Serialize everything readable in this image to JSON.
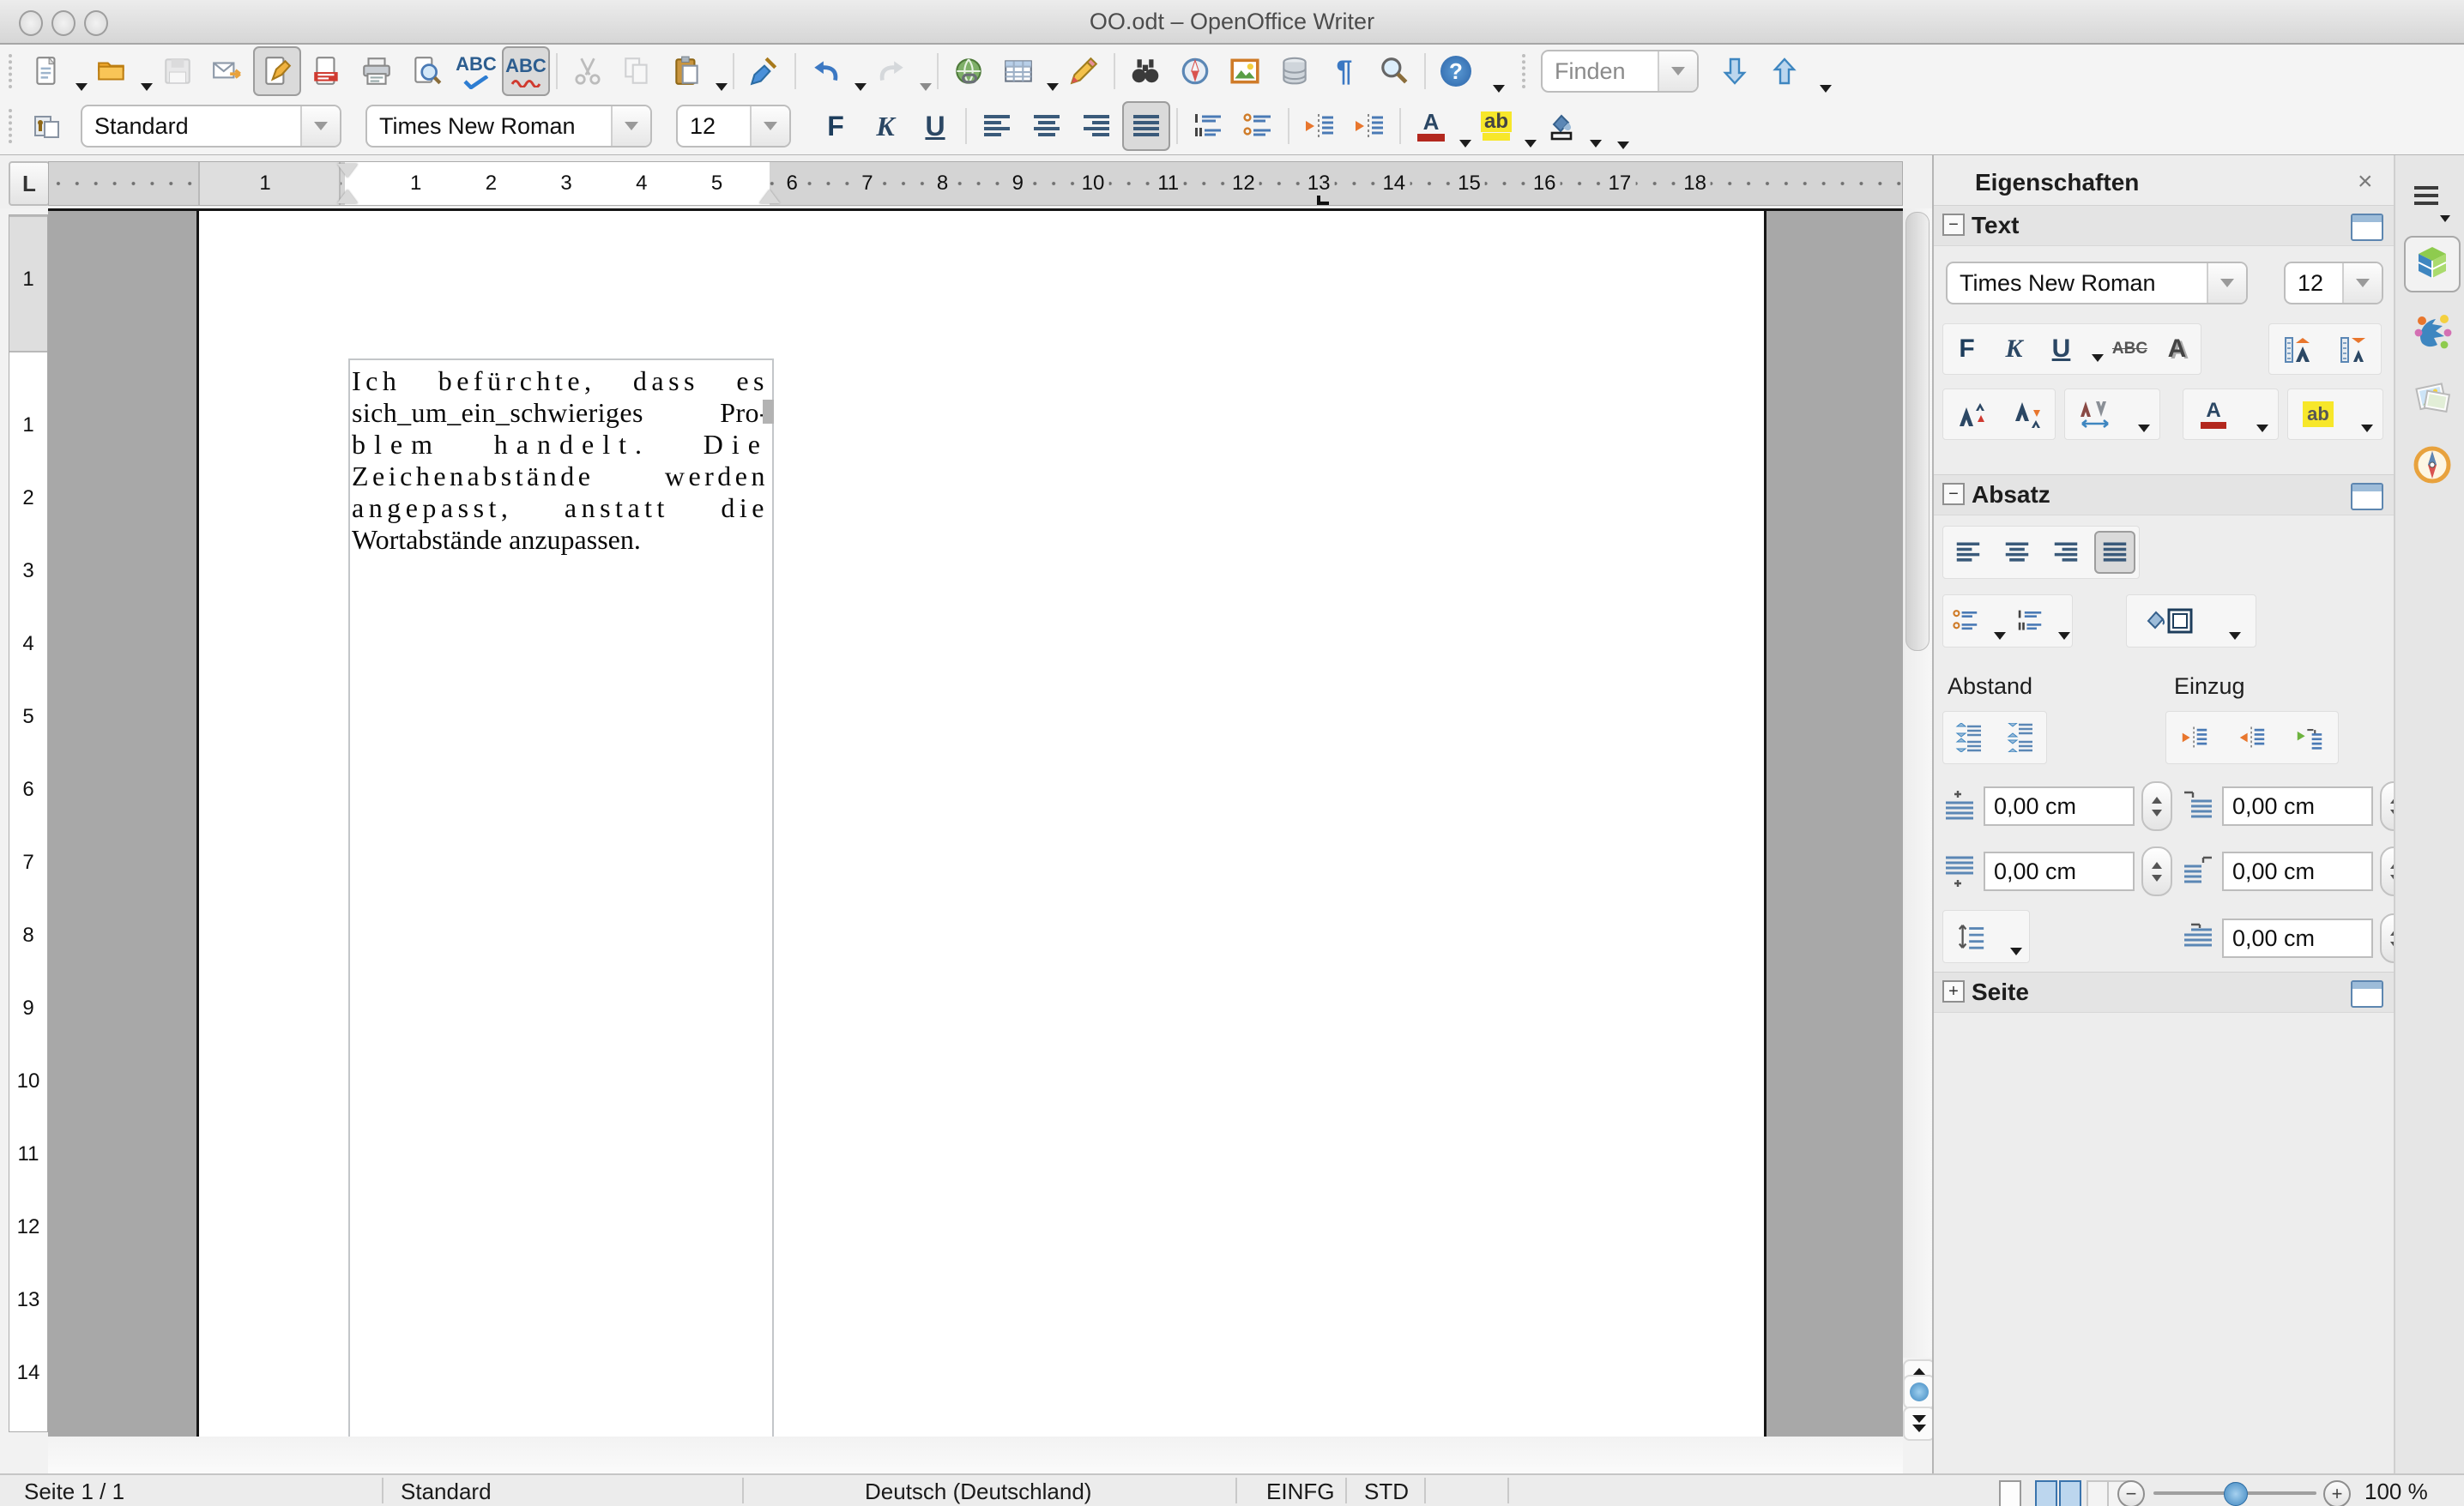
{
  "window": {
    "title": "OO.odt – OpenOffice Writer"
  },
  "glyphs": {
    "tab_type": "L",
    "bold": "F",
    "italic": "K",
    "underline": "U",
    "abc": "ABC",
    "letter_a": "A",
    "letter_ab": "ab",
    "letters_av": "AV",
    "pilcrow": "¶",
    "question": "?",
    "close": "×",
    "collapse": "−",
    "expand": "+",
    "minus": "−",
    "plus": "+"
  },
  "toolbar": {
    "find_placeholder": "Finden"
  },
  "format_toolbar": {
    "paragraph_style": "Standard",
    "font_name": "Times New Roman",
    "font_size": "12"
  },
  "ruler": {
    "h_margin_label": "1",
    "h_numbers": [
      "1",
      "2",
      "3",
      "4",
      "5",
      "6",
      "7",
      "8",
      "9",
      "10",
      "11",
      "12",
      "13",
      "14",
      "15",
      "16",
      "17",
      "18"
    ],
    "v_margin_label": "1",
    "v_numbers": [
      "1",
      "2",
      "3",
      "4",
      "5",
      "6",
      "7",
      "8",
      "9",
      "10",
      "11",
      "12",
      "13",
      "14"
    ]
  },
  "document": {
    "lines": [
      "Ich befürchte, dass es",
      "sich_um_ein_schwieriges Pro-",
      "blem handelt. Die",
      "Zeichenabstände werden",
      "angepasst, anstatt die",
      "Wortabstände anzupassen."
    ]
  },
  "sidebar": {
    "title": "Eigenschaften",
    "text_section": {
      "label": "Text",
      "font_name": "Times New Roman",
      "font_size": "12"
    },
    "paragraph_section": {
      "label": "Absatz",
      "spacing_label": "Abstand",
      "indent_label": "Einzug",
      "spacing_above": "0,00 cm",
      "spacing_below": "0,00 cm",
      "indent_before": "0,00 cm",
      "indent_after": "0,00 cm",
      "indent_firstline": "0,00 cm"
    },
    "page_section": {
      "label": "Seite"
    }
  },
  "status_bar": {
    "page": "Seite 1 / 1",
    "style": "Standard",
    "language": "Deutsch (Deutschland)",
    "insert_mode": "EINFG",
    "selection_mode": "STD",
    "zoom": "100 %"
  },
  "icons": {
    "new-document-icon": "white page with fold",
    "open-icon": "orange folder",
    "save-icon": "floppy disk (disabled)",
    "mail-icon": "envelope with arrow",
    "edit-mode-icon": "page with pencil (active)",
    "export-pdf-icon": "page with red PDF band",
    "print-icon": "printer",
    "page-preview-icon": "page with magnifier",
    "spellcheck-icon": "ABC with check",
    "autospellcheck-icon": "ABC with red wave (active)",
    "cut-icon": "scissors (disabled)",
    "copy-icon": "two pages (disabled)",
    "paste-icon": "clipboard",
    "format-paintbrush-icon": "blue brush",
    "undo-icon": "blue curved arrow",
    "redo-icon": "gray curved arrow (disabled)",
    "hyperlink-icon": "globe with chain",
    "table-icon": "grid",
    "draw-functions-icon": "pencil",
    "find-replace-icon": "binoculars",
    "navigator-icon": "compass",
    "gallery-icon": "picture frame",
    "data-sources-icon": "database cylinder",
    "formatting-marks-icon": "pilcrow",
    "zoom-icon": "magnifier",
    "help-icon": "blue circle question mark",
    "align-left-icon": "bars left",
    "align-center-icon": "bars centered",
    "align-right-icon": "bars right",
    "justify-icon": "bars justified (active)",
    "numbered-list-icon": "numbered lines",
    "bullet-list-icon": "bulleted lines",
    "decrease-indent-icon": "orange arrow left",
    "increase-indent-icon": "orange arrow right",
    "font-color-icon": "A over red bar",
    "highlight-icon": "ab on yellow",
    "background-color-icon": "paint bucket",
    "increase-font-icon": "ruler A up triangle",
    "decrease-font-icon": "ruler A down triangle",
    "superscript-icon": "A raised",
    "subscript-icon": "A lowered",
    "char-spacing-icon": "AV with arrows",
    "spacing-up-icon": "paragraph spacing increase",
    "spacing-down-icon": "paragraph spacing decrease",
    "hanging-indent-icon": "green arrow indent",
    "line-spacing-icon": "vertical arrow with lines",
    "paragraph-background-icon": "bucket with square",
    "properties-tab-icon": "green blue cube (selected)",
    "styles-tab-icon": "stars and swoosh",
    "gallery-tab-icon": "stacked photos",
    "navigator-tab-icon": "orange compass",
    "single-page-icon": "one page",
    "two-page-icon": "two pages (selected)",
    "book-view-icon": "book pages",
    "prev-page-icon": "double up arrows",
    "nav-dot-icon": "blue dot",
    "next-page-icon": "double down arrows"
  }
}
